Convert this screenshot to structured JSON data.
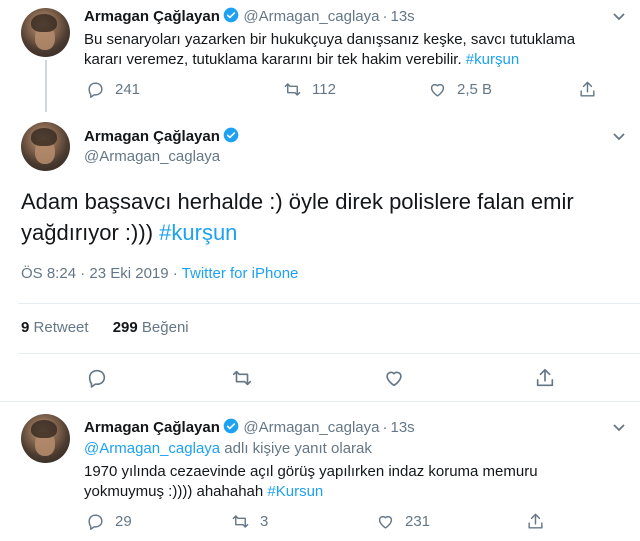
{
  "tweet1": {
    "name": "Armagan Çağlayan",
    "handle": "@Armagan_caglaya",
    "dot": "·",
    "time": "13s",
    "text_line1": "Bu senaryoları yazarken bir hukukçuya danışsanız keşke, savcı tutuklama",
    "text_line2_plain": "kararı veremez, tutuklama kararını bir tek hakim verebilir. ",
    "hashtag": "#kurşun",
    "replies": "241",
    "retweets": "112",
    "likes": "2,5 B"
  },
  "tweet2": {
    "name": "Armagan Çağlayan",
    "handle": "@Armagan_caglaya",
    "text_line1": "Adam başsavcı herhalde :) öyle direk polislere falan emir",
    "text_line2_plain": "yağdırıyor :))) ",
    "hashtag": "#kurşun",
    "time": "ÖS 8:24 · 23 Eki 2019 · ",
    "source": "Twitter for iPhone",
    "retweet_count": "9",
    "retweet_label": "Retweet",
    "like_count": "299",
    "like_label": "Beğeni"
  },
  "tweet3": {
    "name": "Armagan Çağlayan",
    "handle": "@Armagan_caglaya",
    "dot": "·",
    "time": "13s",
    "reply_mention": "@Armagan_caglaya",
    "reply_suffix": " adlı kişiye yanıt olarak",
    "text_line1": "1970 yılında cezaevinde açıl görüş yapılırken indaz koruma memuru",
    "text_line2_plain": "yokmuymuş :)))) ahahahah ",
    "hashtag": "#Kursun",
    "replies": "29",
    "retweets": "3",
    "likes": "231"
  },
  "colors": {
    "accent": "#1da1f2",
    "muted": "#657786",
    "text": "#14171a",
    "divider": "#e6ecf0"
  },
  "icons": [
    "verified-badge-icon",
    "caret-down-icon",
    "reply-icon",
    "retweet-icon",
    "like-icon",
    "share-icon"
  ]
}
